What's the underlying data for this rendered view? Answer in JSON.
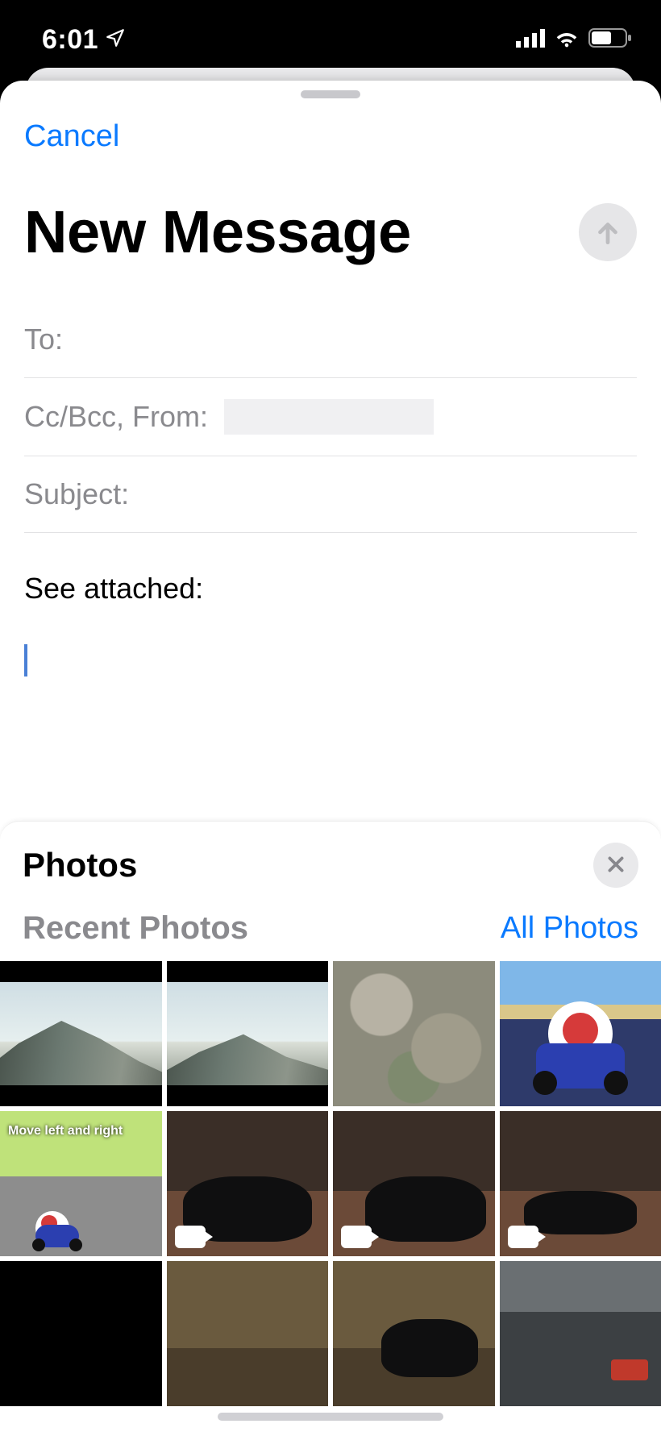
{
  "status": {
    "time": "6:01",
    "location_icon": "location-arrow-icon",
    "signal_bars": 4,
    "wifi_bars": 3,
    "battery_pct": 55
  },
  "compose": {
    "cancel_label": "Cancel",
    "title": "New Message",
    "send_icon": "arrow-up-icon",
    "to_label": "To:",
    "to_value": "",
    "cc_from_label": "Cc/Bcc, From:",
    "cc_from_value": "",
    "subject_label": "Subject:",
    "subject_value": "",
    "body_text": "See attached:"
  },
  "photos": {
    "panel_title": "Photos",
    "close_icon": "close-icon",
    "recent_label": "Recent Photos",
    "all_photos_label": "All Photos",
    "items": [
      {
        "kind": "photo",
        "desc": "mountain ridge landscape",
        "is_video": false
      },
      {
        "kind": "photo",
        "desc": "mountain ridge valley",
        "is_video": false
      },
      {
        "kind": "photo",
        "desc": "rocky terrain aerial",
        "is_video": false
      },
      {
        "kind": "photo",
        "desc": "Mario Kart Toad on track",
        "is_video": false
      },
      {
        "kind": "photo",
        "desc": "Mario Kart move left and right",
        "is_video": false,
        "overlay_text": "Move left and right"
      },
      {
        "kind": "video",
        "desc": "black dog indoors",
        "is_video": true
      },
      {
        "kind": "video",
        "desc": "black dog on blanket",
        "is_video": true
      },
      {
        "kind": "video",
        "desc": "black dog on floor",
        "is_video": true
      },
      {
        "kind": "photo",
        "desc": "dark",
        "is_video": false
      },
      {
        "kind": "photo",
        "desc": "couch cushion",
        "is_video": false
      },
      {
        "kind": "photo",
        "desc": "dog on couch",
        "is_video": false
      },
      {
        "kind": "photo",
        "desc": "car rear",
        "is_video": false
      }
    ]
  },
  "colors": {
    "ios_blue": "#0a7aff",
    "label_gray": "#8a8a8e",
    "disabled_fill": "#e6e6e8"
  }
}
